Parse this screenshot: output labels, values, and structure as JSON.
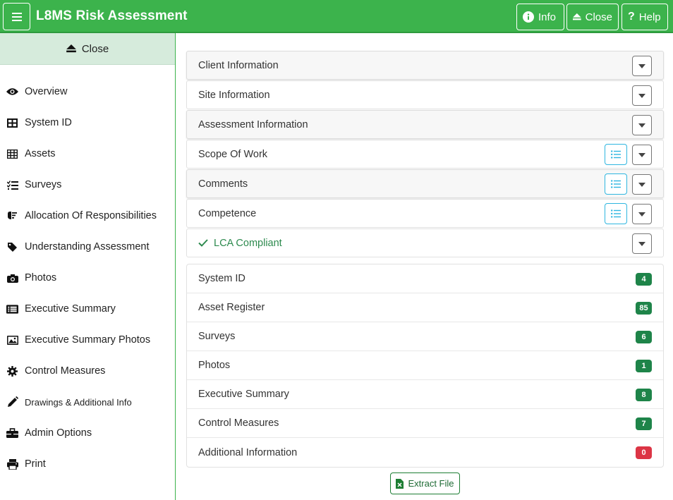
{
  "header": {
    "title": "L8MS Risk Assessment",
    "info_label": "Info",
    "close_label": "Close",
    "help_label": "Help"
  },
  "sidebar": {
    "close_label": "Close",
    "items": [
      {
        "label": "Overview",
        "icon": "eye-icon"
      },
      {
        "label": "System ID",
        "icon": "grid-icon"
      },
      {
        "label": "Assets",
        "icon": "table-icon"
      },
      {
        "label": "Surveys",
        "icon": "checklist-icon"
      },
      {
        "label": "Allocation Of Responsibilities",
        "icon": "hand-icon"
      },
      {
        "label": "Understanding Assessment",
        "icon": "tag-icon"
      },
      {
        "label": "Photos",
        "icon": "camera-icon"
      },
      {
        "label": "Executive Summary",
        "icon": "list-alt-icon"
      },
      {
        "label": "Executive Summary Photos",
        "icon": "image-icon"
      },
      {
        "label": "Control Measures",
        "icon": "gear-icon"
      },
      {
        "label": "Drawings & Additional Info",
        "icon": "pencil-icon"
      },
      {
        "label": "Admin Options",
        "icon": "toolbox-icon"
      },
      {
        "label": "Print",
        "icon": "print-icon"
      }
    ]
  },
  "sections": [
    {
      "label": "Client Information"
    },
    {
      "label": "Site Information"
    },
    {
      "label": "Assessment Information"
    },
    {
      "label": "Scope Of Work"
    },
    {
      "label": "Comments"
    },
    {
      "label": "Competence"
    },
    {
      "label": "LCA Compliant"
    }
  ],
  "counts": [
    {
      "label": "System ID",
      "count": "4",
      "color": "#1e8449"
    },
    {
      "label": "Asset Register",
      "count": "85",
      "color": "#1e8449"
    },
    {
      "label": "Surveys",
      "count": "6",
      "color": "#1e8449"
    },
    {
      "label": "Photos",
      "count": "1",
      "color": "#1e8449"
    },
    {
      "label": "Executive Summary",
      "count": "8",
      "color": "#1e8449"
    },
    {
      "label": "Control Measures",
      "count": "7",
      "color": "#1e8449"
    },
    {
      "label": "Additional Information",
      "count": "0",
      "color": "#dc3545"
    }
  ],
  "extract_label": "Extract File",
  "colors": {
    "brand": "#3cb34c",
    "badge_ok": "#1e8449",
    "badge_zero": "#dc3545",
    "list_btn": "#2fb6e0"
  }
}
